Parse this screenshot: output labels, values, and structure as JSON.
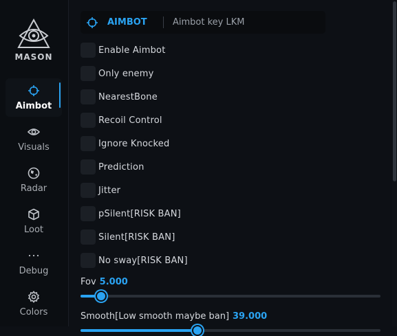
{
  "brand": {
    "name": "MASON",
    "logo_icon": "eye-triangle-icon"
  },
  "sidebar": {
    "items": [
      {
        "label": "Aimbot",
        "icon": "crosshair-icon",
        "active": true
      },
      {
        "label": "Visuals",
        "icon": "eye-icon",
        "active": false
      },
      {
        "label": "Radar",
        "icon": "globe-icon",
        "active": false
      },
      {
        "label": "Loot",
        "icon": "box-icon",
        "active": false
      },
      {
        "label": "Debug",
        "icon": "dots-icon",
        "active": false
      },
      {
        "label": "Colors",
        "icon": "gear-icon",
        "active": false
      }
    ]
  },
  "header": {
    "title": "AIMBOT",
    "subtitle": "Aimbot key LKM"
  },
  "options": [
    {
      "label": "Enable Aimbot",
      "checked": false
    },
    {
      "label": "Only enemy",
      "checked": false
    },
    {
      "label": "NearestBone",
      "checked": false
    },
    {
      "label": "Recoil Control",
      "checked": false
    },
    {
      "label": "Ignore Knocked",
      "checked": false
    },
    {
      "label": "Prediction",
      "checked": false
    },
    {
      "label": "Jitter",
      "checked": false
    },
    {
      "label": "pSilent[RISK BAN]",
      "checked": false
    },
    {
      "label": "Silent[RISK BAN]",
      "checked": false
    },
    {
      "label": "No sway[RISK BAN]",
      "checked": false
    }
  ],
  "sliders": [
    {
      "label": "Fov",
      "value": "5.000",
      "fraction": 0.069
    },
    {
      "label": "Smooth[Low smooth maybe ban]",
      "value": "39.000",
      "fraction": 0.39
    }
  ],
  "colors": {
    "accent": "#2aa3f2",
    "background": "#0d1015",
    "sidebar": "#0b0e12"
  }
}
